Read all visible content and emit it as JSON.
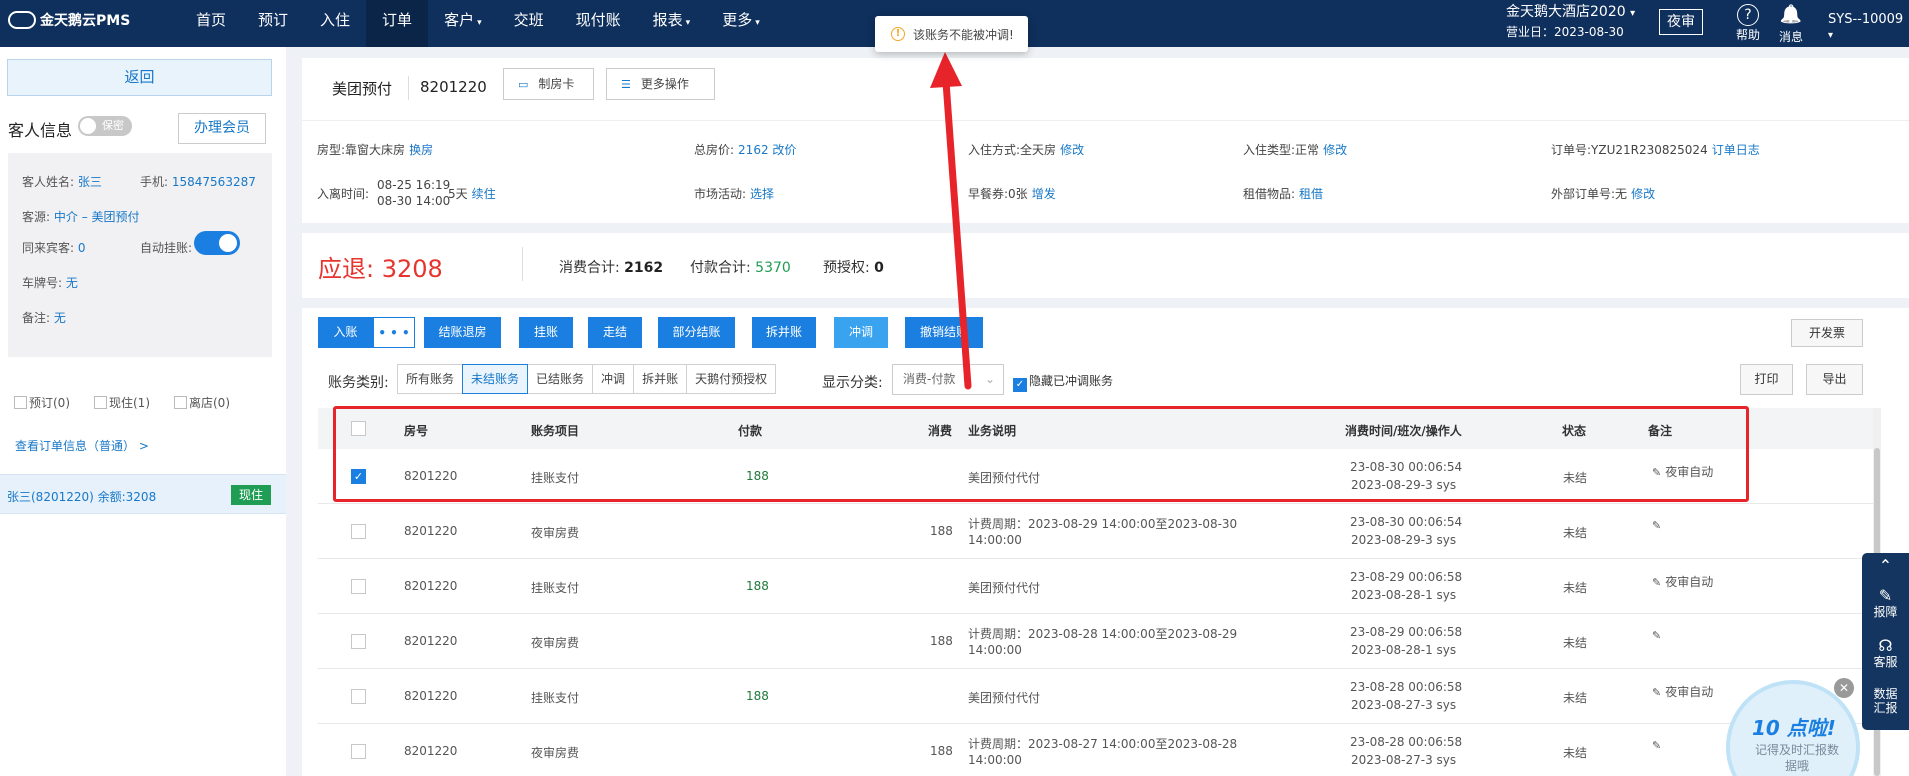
{
  "app": {
    "brand": "金天鹅云PMS"
  },
  "nav": [
    {
      "label": "首页",
      "caret": ""
    },
    {
      "label": "预订",
      "caret": ""
    },
    {
      "label": "入住",
      "caret": ""
    },
    {
      "label": "订单",
      "caret": ""
    },
    {
      "label": "客户",
      "caret": "▾"
    },
    {
      "label": "交班",
      "caret": ""
    },
    {
      "label": "现付账",
      "caret": ""
    },
    {
      "label": "报表",
      "caret": "▾"
    },
    {
      "label": "更多",
      "caret": "▾"
    }
  ],
  "header": {
    "hotel": "金天鹅大酒店2020",
    "hotel_caret": "▾",
    "biz_date": "营业日：2023-08-30",
    "night_audit": "夜审",
    "help": "帮助",
    "help_icon": "?",
    "messages": "消息",
    "messages_icon": "🔔",
    "user": "SYS--10009",
    "user_caret": "▾"
  },
  "toast": {
    "icon": "!",
    "text": "该账务不能被冲调!"
  },
  "sidebar": {
    "back": "返回",
    "guest_info_title": "客人信息",
    "secret_toggle": "保密",
    "member_button": "办理会员",
    "guest": {
      "name_label": "客人姓名:",
      "name": "张三",
      "phone_label": "手机:",
      "phone": "15847563287",
      "source_label": "客源:",
      "source": "中介 – 美团预付",
      "companions_label": "同来宾客:",
      "companions": "0",
      "auto_hang_label": "自动挂账:",
      "plate_label": "车牌号:",
      "plate": "无",
      "remark_label": "备注:",
      "remark": "无"
    },
    "stats": [
      {
        "label": "预订(0)"
      },
      {
        "label": "现住(1)"
      },
      {
        "label": "离店(0)"
      }
    ],
    "view_order": "查看订单信息（普通） >",
    "guest_row": {
      "text": "张三(8201220)  余额:3208",
      "badge": "现住"
    }
  },
  "order": {
    "source": "美团预付",
    "number": "8201220",
    "make_card": "制房卡",
    "more_ops": "更多操作",
    "make_card_icon": "▭",
    "more_ops_icon": "☰"
  },
  "info": {
    "room_type_label": "房型:",
    "room_type": "靠窗大床房",
    "room_type_action": "换房",
    "total_price_label": "总房价:",
    "total_price": "2162 改价",
    "checkin_mode_label": "入住方式:",
    "checkin_mode": "全天房",
    "checkin_mode_action": "修改",
    "checkin_type_label": "入住类型:",
    "checkin_type": "正常",
    "checkin_type_action": "修改",
    "order_no_label": "订单号:",
    "order_no": "YZU21R230825024",
    "order_log": "订单日志",
    "stay_label": "入离时间:",
    "stay_in": "08-25 16:19",
    "stay_out": "08-30 14:00",
    "stay_days": "5天",
    "stay_action": "续住",
    "campaign_label": "市场活动:",
    "campaign_action": "选择",
    "breakfast_label": "早餐券:",
    "breakfast": "0张",
    "breakfast_action": "增发",
    "rental_label": "租借物品:",
    "rental_action": "租借",
    "ext_order_label": "外部订单号:",
    "ext_order": "无",
    "ext_order_action": "修改"
  },
  "summary": {
    "refund_label": "应退:",
    "refund": "3208",
    "consume_label": "消费合计:",
    "consume": "2162",
    "payment_label": "付款合计:",
    "payment": "5370",
    "preauth_label": "预授权:",
    "preauth": "0"
  },
  "actions": {
    "enter": "入账",
    "enter_more": "• • •",
    "checkout": "结账退房",
    "hang": "挂账",
    "walk": "走结",
    "partial": "部分结账",
    "split_merge": "拆并账",
    "adjust": "冲调",
    "cancel": "撤销结账",
    "invoice": "开发票",
    "print": "打印",
    "export": "导出"
  },
  "filters": {
    "category_label": "账务类别:",
    "tabs": [
      "所有账务",
      "未结账务",
      "已结账务",
      "冲调",
      "拆并账",
      "天鹅付预授权"
    ],
    "display_label": "显示分类:",
    "display_value": "消费-付款",
    "display_arrow": "⌄",
    "hide_adjusted": "隐藏已冲调账务"
  },
  "table": {
    "headers": [
      "房号",
      "账务项目",
      "付款",
      "消费",
      "业务说明",
      "消费时间/班次/操作人",
      "状态",
      "备注"
    ],
    "rows": [
      {
        "room": "8201220",
        "item": "挂账支付",
        "pay": "188",
        "consume": "",
        "desc1": "美团预付代付",
        "desc2": "",
        "time1": "23-08-30 00:06:54",
        "time2": "2023-08-29-3 sys",
        "status": "未结",
        "note": "夜审自动",
        "checked": "✓"
      },
      {
        "room": "8201220",
        "item": "夜审房费",
        "pay": "",
        "consume": "188",
        "desc1": "计费周期：2023-08-29 14:00:00至2023-08-30",
        "desc2": "14:00:00",
        "time1": "23-08-30 00:06:54",
        "time2": "2023-08-29-3 sys",
        "status": "未结",
        "note": "",
        "checked": ""
      },
      {
        "room": "8201220",
        "item": "挂账支付",
        "pay": "188",
        "consume": "",
        "desc1": "美团预付代付",
        "desc2": "",
        "time1": "23-08-29 00:06:58",
        "time2": "2023-08-28-1 sys",
        "status": "未结",
        "note": "夜审自动",
        "checked": ""
      },
      {
        "room": "8201220",
        "item": "夜审房费",
        "pay": "",
        "consume": "188",
        "desc1": "计费周期：2023-08-28 14:00:00至2023-08-29",
        "desc2": "14:00:00",
        "time1": "23-08-29 00:06:58",
        "time2": "2023-08-28-1 sys",
        "status": "未结",
        "note": "",
        "checked": ""
      },
      {
        "room": "8201220",
        "item": "挂账支付",
        "pay": "188",
        "consume": "",
        "desc1": "美团预付代付",
        "desc2": "",
        "time1": "23-08-28 00:06:58",
        "time2": "2023-08-27-3 sys",
        "status": "未结",
        "note": "夜审自动",
        "checked": ""
      },
      {
        "room": "8201220",
        "item": "夜审房费",
        "pay": "",
        "consume": "188",
        "desc1": "计费周期：2023-08-27 14:00:00至2023-08-28",
        "desc2": "14:00:00",
        "time1": "23-08-28 00:06:58",
        "time2": "2023-08-27-3 sys",
        "status": "未结",
        "note": "",
        "checked": ""
      }
    ]
  },
  "tools": [
    {
      "icon": "⌃",
      "label": ""
    },
    {
      "icon": "✎",
      "label": "报障"
    },
    {
      "icon": "☊",
      "label": "客服"
    },
    {
      "icon": "",
      "label": "数据汇报"
    }
  ],
  "promo": {
    "title": "10 点啦!",
    "text": "记得及时汇报数据哦",
    "close": "✕"
  },
  "colors": {
    "nav_bg": "#0f2f5c",
    "primary": "#1a7fe0",
    "refund": "#e5352e",
    "payment": "#1f9d55",
    "annotation": "#e8242b"
  }
}
